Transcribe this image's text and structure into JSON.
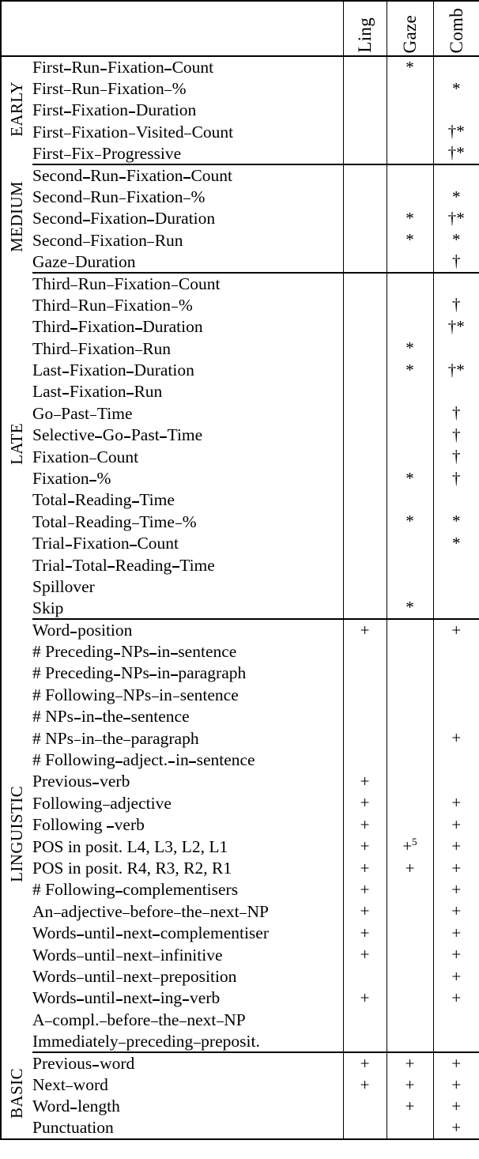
{
  "table": {
    "columns": {
      "category_header": "",
      "feature_header": "",
      "ling": "Ling",
      "gaze": "Gaze",
      "comb": "Comb"
    },
    "sections": [
      {
        "label": "EARLY",
        "rows": [
          {
            "feature": "First_Run_Fixation_Count",
            "ling": "",
            "gaze": "*",
            "comb": ""
          },
          {
            "feature": "First_Run_Fixation_%",
            "ling": "",
            "gaze": "",
            "comb": "*"
          },
          {
            "feature": "First_Fixation_Duration",
            "ling": "",
            "gaze": "",
            "comb": ""
          },
          {
            "feature": "First_Fixation_Visited_Count",
            "ling": "",
            "gaze": "",
            "comb": "†*"
          },
          {
            "feature": "First_Fix_Progressive",
            "ling": "",
            "gaze": "",
            "comb": "†*"
          }
        ]
      },
      {
        "label": "MEDIUM",
        "rows": [
          {
            "feature": "Second_Run_Fixation_Count",
            "ling": "",
            "gaze": "",
            "comb": ""
          },
          {
            "feature": "Second_Run_Fixation_%",
            "ling": "",
            "gaze": "",
            "comb": "*"
          },
          {
            "feature": "Second_Fixation_Duration",
            "ling": "",
            "gaze": "*",
            "comb": "†*"
          },
          {
            "feature": "Second_Fixation_Run",
            "ling": "",
            "gaze": "*",
            "comb": "*"
          },
          {
            "feature": "Gaze_Duration",
            "ling": "",
            "gaze": "",
            "comb": "†"
          }
        ]
      },
      {
        "label": "LATE",
        "rows": [
          {
            "feature": "Third_Run_Fixation_Count",
            "ling": "",
            "gaze": "",
            "comb": ""
          },
          {
            "feature": "Third_Run_Fixation_%",
            "ling": "",
            "gaze": "",
            "comb": "†"
          },
          {
            "feature": "Third_Fixation_Duration",
            "ling": "",
            "gaze": "",
            "comb": "†*"
          },
          {
            "feature": "Third_Fixation_Run",
            "ling": "",
            "gaze": "*",
            "comb": ""
          },
          {
            "feature": "Last_Fixation_Duration",
            "ling": "",
            "gaze": "*",
            "comb": "†*"
          },
          {
            "feature": "Last_Fixation_Run",
            "ling": "",
            "gaze": "",
            "comb": ""
          },
          {
            "feature": "Go_Past_Time",
            "ling": "",
            "gaze": "",
            "comb": "†"
          },
          {
            "feature": "Selective_Go_Past_Time",
            "ling": "",
            "gaze": "",
            "comb": "†"
          },
          {
            "feature": "Fixation_Count",
            "ling": "",
            "gaze": "",
            "comb": "†"
          },
          {
            "feature": "Fixation_%",
            "ling": "",
            "gaze": "*",
            "comb": "†"
          },
          {
            "feature": "Total_Reading_Time",
            "ling": "",
            "gaze": "",
            "comb": ""
          },
          {
            "feature": "Total_Reading_Time_%",
            "ling": "",
            "gaze": "*",
            "comb": "*"
          },
          {
            "feature": "Trial_Fixation_Count",
            "ling": "",
            "gaze": "",
            "comb": "*"
          },
          {
            "feature": "Trial_Total_Reading_Time",
            "ling": "",
            "gaze": "",
            "comb": ""
          },
          {
            "feature": "Spillover",
            "ling": "",
            "gaze": "",
            "comb": ""
          },
          {
            "feature": "Skip",
            "ling": "",
            "gaze": "*",
            "comb": ""
          }
        ]
      },
      {
        "label": "LINGUISTIC",
        "rows": [
          {
            "feature": "Word_position",
            "ling": "+",
            "gaze": "",
            "comb": "+"
          },
          {
            "feature": "# Preceding_NPs_in_sentence",
            "ling": "",
            "gaze": "",
            "comb": ""
          },
          {
            "feature": "# Preceding_NPs_in_paragraph",
            "ling": "",
            "gaze": "",
            "comb": ""
          },
          {
            "feature": "# Following_NPs_in_sentence",
            "ling": "",
            "gaze": "",
            "comb": ""
          },
          {
            "feature": "# NPs_in_the_sentence",
            "ling": "",
            "gaze": "",
            "comb": ""
          },
          {
            "feature": "# NPs_in_the_paragraph",
            "ling": "",
            "gaze": "",
            "comb": "+"
          },
          {
            "feature": "# Following_adject._in_sentence",
            "ling": "",
            "gaze": "",
            "comb": ""
          },
          {
            "feature": "Previous_verb",
            "ling": "+",
            "gaze": "",
            "comb": ""
          },
          {
            "feature": "Following_adjective",
            "ling": "+",
            "gaze": "",
            "comb": "+"
          },
          {
            "feature": "Following _verb",
            "ling": "+",
            "gaze": "",
            "comb": "+"
          },
          {
            "feature": "POS in posit. L4, L3, L2, L1",
            "ling": "+",
            "gaze": "+^5",
            "comb": "+"
          },
          {
            "feature": "POS in posit. R4, R3, R2, R1",
            "ling": "+",
            "gaze": "+",
            "comb": "+"
          },
          {
            "feature": "# Following_complementisers",
            "ling": "+",
            "gaze": "",
            "comb": "+"
          },
          {
            "feature": "An_adjective_before_the_next_NP",
            "ling": "+",
            "gaze": "",
            "comb": "+"
          },
          {
            "feature": "Words_until_next_complementiser",
            "ling": "+",
            "gaze": "",
            "comb": "+"
          },
          {
            "feature": "Words_until_next_infinitive",
            "ling": "+",
            "gaze": "",
            "comb": "+"
          },
          {
            "feature": "Words_until_next_preposition",
            "ling": "",
            "gaze": "",
            "comb": "+"
          },
          {
            "feature": "Words_until_next_ing_verb",
            "ling": "+",
            "gaze": "",
            "comb": "+"
          },
          {
            "feature": "A_compl._before_the_next_NP",
            "ling": "",
            "gaze": "",
            "comb": ""
          },
          {
            "feature": "Immediately_preceding_preposit.",
            "ling": "",
            "gaze": "",
            "comb": ""
          }
        ]
      },
      {
        "label": "BASIC",
        "rows": [
          {
            "feature": "Previous_word",
            "ling": "+",
            "gaze": "+",
            "comb": "+"
          },
          {
            "feature": "Next_word",
            "ling": "+",
            "gaze": "+",
            "comb": "+"
          },
          {
            "feature": "Word_length",
            "ling": "",
            "gaze": "+",
            "comb": "+"
          },
          {
            "feature": "Punctuation",
            "ling": "",
            "gaze": "",
            "comb": "+"
          }
        ]
      }
    ]
  }
}
